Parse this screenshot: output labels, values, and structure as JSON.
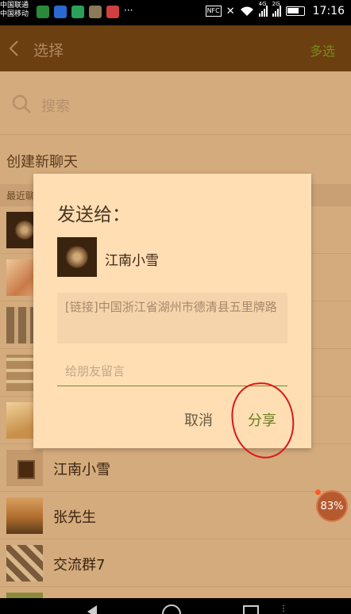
{
  "status_bar": {
    "carrier1": "中国联通",
    "carrier2": "中国移动",
    "nfc": "NFC",
    "sig1_label": "4G",
    "sig2_label": "2G",
    "time": "17:16"
  },
  "header": {
    "title": "选择",
    "multi_select": "多选"
  },
  "search": {
    "placeholder": "搜索"
  },
  "create_chat": "创建新聊天",
  "section_label": "最近聊天",
  "chats": [
    {
      "name": "",
      "avatar": "coin-avatar"
    },
    {
      "name": "",
      "avatar": "child-photo-avatar"
    },
    {
      "name": "",
      "avatar": "grid-avatar"
    },
    {
      "name": "",
      "avatar": "grid2-avatar"
    },
    {
      "name": "",
      "avatar": "hand-avatar"
    },
    {
      "name": "江南小雪",
      "avatar": "frame-avatar"
    },
    {
      "name": "张先生",
      "avatar": "city-avatar"
    },
    {
      "name": "交流群7",
      "avatar": "collage-avatar"
    },
    {
      "name": "",
      "avatar": "green-avatar"
    }
  ],
  "progress_badge": "83%",
  "dialog": {
    "title": "发送给：",
    "recipient": "江南小雪",
    "link_text": "[链接]中国浙江省湖州市德清县五里牌路",
    "message_placeholder": "给朋友留言",
    "cancel": "取消",
    "share": "分享"
  },
  "colors": {
    "header_bg": "#6b3f10",
    "dialog_bg": "#ffdeb4",
    "accent_green": "#6a7f1c",
    "annotation_red": "#d8181a"
  }
}
